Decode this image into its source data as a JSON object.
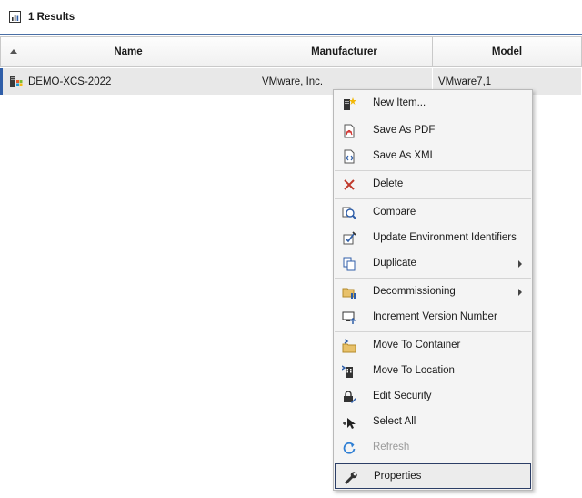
{
  "results": {
    "label": "1 Results",
    "icon": "report-chart-icon"
  },
  "grid": {
    "columns": [
      {
        "label": "Name",
        "sort": "ascending"
      },
      {
        "label": "Manufacturer"
      },
      {
        "label": "Model"
      }
    ],
    "rows": [
      {
        "name": "DEMO-XCS-2022",
        "manufacturer": "VMware, Inc.",
        "model": "VMware7,1",
        "icon": "windows-server-icon"
      }
    ],
    "accent_color": "#2f5ea8"
  },
  "context_menu": {
    "items": [
      {
        "label": "New Item...",
        "icon": "new-item-icon"
      },
      {
        "label": "Save As PDF",
        "icon": "pdf-icon"
      },
      {
        "label": "Save As XML",
        "icon": "xml-icon"
      },
      {
        "label": "Delete",
        "icon": "delete-x-icon"
      },
      {
        "label": "Compare",
        "icon": "compare-magnifier-icon"
      },
      {
        "label": "Update Environment Identifiers",
        "icon": "update-identifiers-icon"
      },
      {
        "label": "Duplicate",
        "icon": "duplicate-icon",
        "submenu": true
      },
      {
        "label": "Decommissioning",
        "icon": "decommission-icon",
        "submenu": true
      },
      {
        "label": "Increment Version Number",
        "icon": "increment-version-icon"
      },
      {
        "label": "Move To Container",
        "icon": "move-container-icon"
      },
      {
        "label": "Move To Location",
        "icon": "move-location-icon"
      },
      {
        "label": "Edit Security",
        "icon": "edit-security-icon"
      },
      {
        "label": "Select All",
        "icon": "select-all-icon"
      },
      {
        "label": "Refresh",
        "icon": "refresh-icon",
        "disabled": true
      },
      {
        "label": "Properties",
        "icon": "wrench-icon",
        "highlighted": true
      }
    ]
  }
}
